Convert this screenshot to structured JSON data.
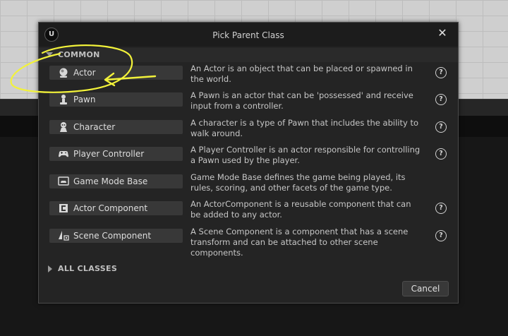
{
  "dialog": {
    "title": "Pick Parent Class",
    "logo_text": "U",
    "close_glyph": "✕",
    "common_section": "COMMON",
    "all_classes_section": "ALL CLASSES",
    "cancel_label": "Cancel"
  },
  "classes": [
    {
      "label": "Actor",
      "icon": "actor-icon",
      "description": "An Actor is an object that can be placed or spawned in the world.",
      "help": "?"
    },
    {
      "label": "Pawn",
      "icon": "pawn-icon",
      "description": "A Pawn is an actor that can be 'possessed' and receive input from a controller.",
      "help": "?"
    },
    {
      "label": "Character",
      "icon": "character-icon",
      "description": "A character is a type of Pawn that includes the ability to walk around.",
      "help": "?"
    },
    {
      "label": "Player Controller",
      "icon": "gamepad-icon",
      "description": "A Player Controller is an actor responsible for controlling a Pawn used by the player.",
      "help": "?"
    },
    {
      "label": "Game Mode Base",
      "icon": "game-mode-icon",
      "description": "Game Mode Base defines the game being played, its rules, scoring, and other facets of the game type.",
      "help": ""
    },
    {
      "label": "Actor Component",
      "icon": "component-icon",
      "description": "An ActorComponent is a reusable component that can be added to any actor.",
      "help": "?"
    },
    {
      "label": "Scene Component",
      "icon": "scene-component-icon",
      "description": "A Scene Component is a component that has a scene transform and can be attached to other scene components.",
      "help": "?"
    }
  ],
  "colors": {
    "dialog_bg": "#242424",
    "button_bg": "#383838",
    "annotation": "#f2f23a"
  }
}
